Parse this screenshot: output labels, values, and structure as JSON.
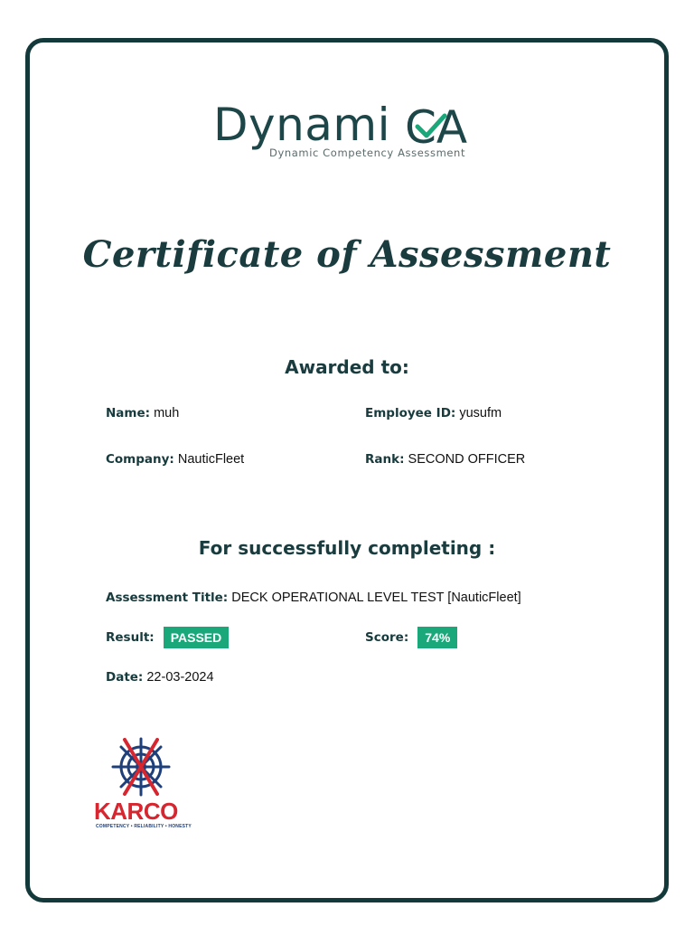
{
  "logo": {
    "wordmark": "Dynami",
    "wordmark_ca": "CA",
    "tagline": "Dynamic Competency Assessment",
    "brand_color": "#1d4649",
    "check_color": "#1aa77a"
  },
  "title": "Certificate of Assessment",
  "awarded": {
    "heading": "Awarded to:",
    "name_label": "Name:",
    "name_value": "muh",
    "employee_id_label": "Employee ID:",
    "employee_id_value": "yusufm",
    "company_label": "Company:",
    "company_value": "NauticFleet",
    "rank_label": "Rank:",
    "rank_value": "SECOND OFFICER"
  },
  "completion": {
    "heading": "For successfully completing :",
    "assessment_title_label": "Assessment Title:",
    "assessment_title_value": "DECK OPERATIONAL LEVEL TEST [NauticFleet]",
    "result_label": "Result:",
    "result_value": "PASSED",
    "score_label": "Score:",
    "score_value": "74%",
    "date_label": "Date:",
    "date_value": "22-03-2024"
  },
  "karco": {
    "wordmark": "KARCO",
    "tagline": "COMPETENCY • RELIABILITY • HONESTY",
    "red": "#d6262f",
    "navy": "#1f3f7a"
  },
  "colors": {
    "frame": "#14393b",
    "badge": "#1aa77a"
  }
}
